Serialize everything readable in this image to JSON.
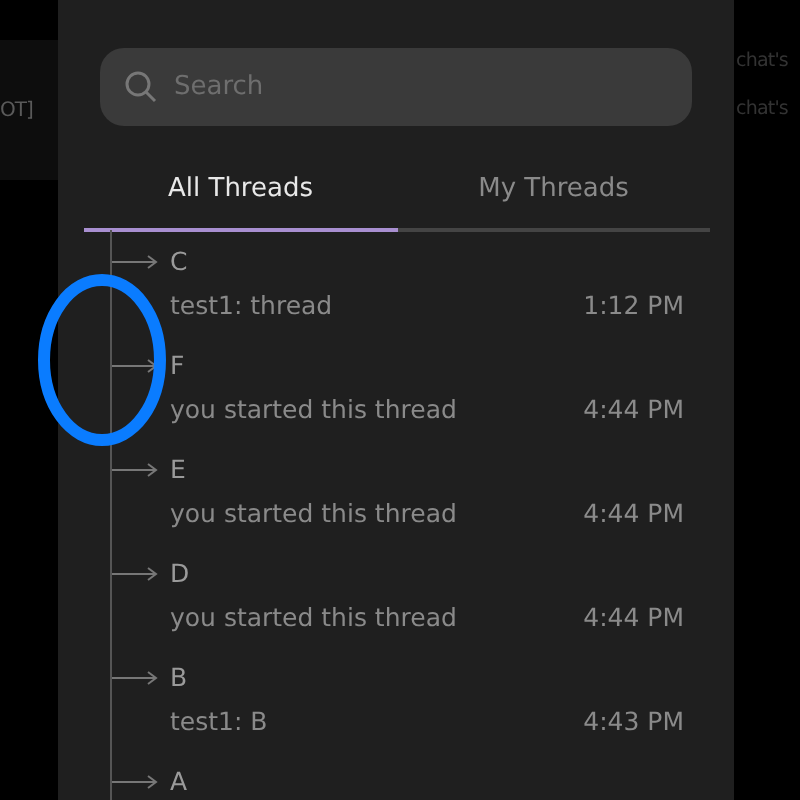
{
  "backdrop": {
    "left_text": "OT]",
    "right_texts": [
      "chat's",
      "chat's"
    ]
  },
  "search": {
    "placeholder": "Search"
  },
  "tabs": [
    {
      "label": "All Threads",
      "selected": true
    },
    {
      "label": "My Threads",
      "selected": false
    }
  ],
  "threads": [
    {
      "title": "C",
      "subtitle": "test1: thread",
      "time": "1:12 PM"
    },
    {
      "title": "F",
      "subtitle": "you started this thread",
      "time": "4:44 PM"
    },
    {
      "title": "E",
      "subtitle": "you started this thread",
      "time": "4:44 PM"
    },
    {
      "title": "D",
      "subtitle": "you started this thread",
      "time": "4:44 PM"
    },
    {
      "title": "B",
      "subtitle": "test1: B",
      "time": "4:43 PM"
    },
    {
      "title": "A"
    }
  ]
}
